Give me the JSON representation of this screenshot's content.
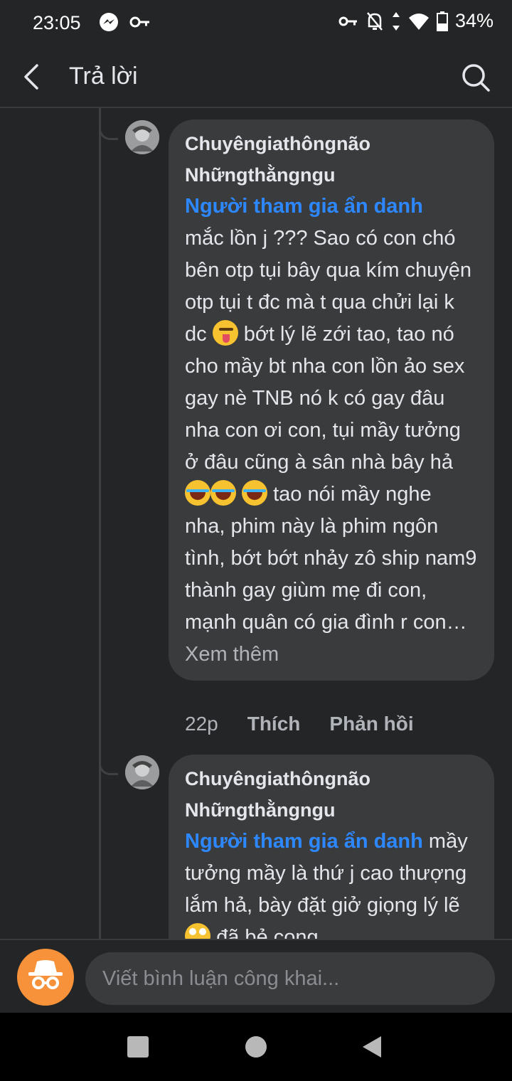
{
  "status_bar": {
    "time": "23:05",
    "battery": "34%",
    "left_icons": [
      "messenger-icon",
      "key-icon"
    ],
    "right_icons": [
      "vpn-key-icon",
      "bell-off-icon",
      "data-arrows-icon",
      "wifi-icon",
      "battery-icon"
    ]
  },
  "header": {
    "title": "Trả lời",
    "back_icon": "chevron-left-icon",
    "search_icon": "search-icon"
  },
  "comments": [
    {
      "author_line1": "Chuyêngiathôngnão",
      "author_line2": "Nhữngthằngngu",
      "mention": "Người tham gia ẩn danh",
      "text_part1": "mắc lồn j ??? Sao có con chó bên otp tụi bây qua kím chuyện otp tụi t đc mà t qua chửi lại k dc",
      "text_part2": "bớt lý lẽ zới tao, tao nó cho mầy bt nha con lồn ảo sex gay nè TNB nó k có gay đâu nha con ơi con, tụi mầy tưởng ở đâu cũng à sân nhà bây hả",
      "text_part3": "tao nói mầy nghe nha, phim này là phim ngôn tình, bớt bớt nhảy zô ship nam9 thành gay giùm mẹ đi con, mạnh quân có gia đình r con…",
      "see_more": "Xem thêm",
      "time": "22p",
      "like": "Thích",
      "reply": "Phản hồi"
    },
    {
      "author_line1": "Chuyêngiathôngnão",
      "author_line2": "Nhữngthằngngu",
      "mention": "Người tham gia ẩn danh",
      "text_part1": "mầy tưởng mầy là thứ j cao thượng lắm hả, bày đặt giở giọng lý lẽ",
      "text_part2": "đã bẻ cong"
    }
  ],
  "composer": {
    "placeholder": "Viết bình luận công khai...",
    "avatar_icon": "incognito-icon"
  },
  "nav": {
    "recents_icon": "square-icon",
    "home_icon": "circle-icon",
    "back_icon": "triangle-back-icon"
  },
  "colors": {
    "background": "#242526",
    "bubble": "#3a3b3c",
    "mention": "#2d88ff",
    "secondary_text": "#b0b3b8",
    "anon_avatar": "#f7923a"
  }
}
